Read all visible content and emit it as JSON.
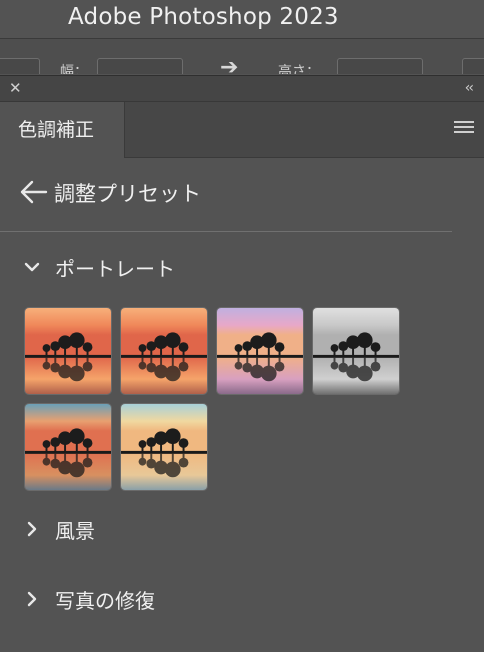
{
  "app": {
    "title": "Adobe Photoshop 2023"
  },
  "options_bar": {
    "width_label": "幅：",
    "height_label": "高さ："
  },
  "panel": {
    "tab_label": "色調補正",
    "page_title": "調整プリセット",
    "sections": [
      {
        "label": "ポートレート",
        "expanded": true
      },
      {
        "label": "風景",
        "expanded": false
      },
      {
        "label": "写真の修復",
        "expanded": false
      }
    ],
    "presets": [
      {
        "name": "preset-warm-1",
        "tone": "warm"
      },
      {
        "name": "preset-warm-2",
        "tone": "warm"
      },
      {
        "name": "preset-cool-pink",
        "tone": "pink"
      },
      {
        "name": "preset-black-white",
        "tone": "mono"
      },
      {
        "name": "preset-teal-orange",
        "tone": "teal"
      },
      {
        "name": "preset-light-teal",
        "tone": "light"
      }
    ]
  },
  "colors": {
    "panel_bg": "#535353",
    "header_bg": "#454545",
    "text": "#f0f0f0"
  }
}
